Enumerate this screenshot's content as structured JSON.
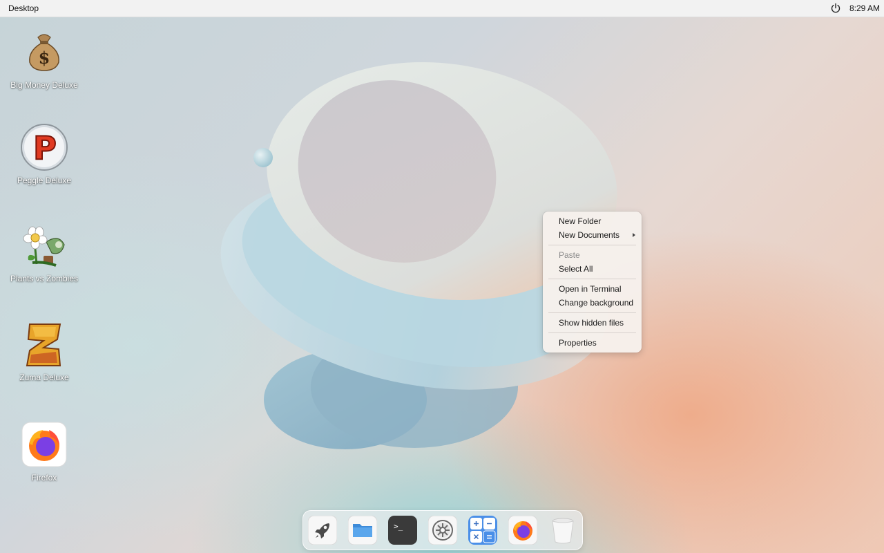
{
  "topbar": {
    "title": "Desktop",
    "time": "8:29 AM",
    "power_icon": "power-icon"
  },
  "desktop_icons": [
    {
      "label": "Big Money Deluxe",
      "icon": "money-bag-icon"
    },
    {
      "label": "Peggle Deluxe",
      "icon": "peggle-icon"
    },
    {
      "label": "Plants vs Zombies",
      "icon": "plants-vs-zombies-icon"
    },
    {
      "label": "Zuma Deluxe",
      "icon": "zuma-icon"
    },
    {
      "label": "Firefox",
      "icon": "firefox-icon"
    }
  ],
  "context_menu": {
    "items": [
      {
        "label": "New Folder",
        "enabled": true
      },
      {
        "label": "New Documents",
        "enabled": true,
        "submenu": true
      },
      {
        "label": "Paste",
        "enabled": false
      },
      {
        "label": "Select All",
        "enabled": true
      },
      {
        "label": "Open in Terminal",
        "enabled": true
      },
      {
        "label": "Change background",
        "enabled": true
      },
      {
        "label": "Show hidden files",
        "enabled": true
      },
      {
        "label": "Properties",
        "enabled": true
      }
    ]
  },
  "dock": {
    "apps": [
      {
        "name": "launcher",
        "icon": "rocket-icon"
      },
      {
        "name": "files",
        "icon": "folder-icon"
      },
      {
        "name": "terminal",
        "icon": "terminal-icon"
      },
      {
        "name": "settings",
        "icon": "gear-icon"
      },
      {
        "name": "calculator",
        "icon": "calculator-icon"
      },
      {
        "name": "firefox",
        "icon": "firefox-icon"
      },
      {
        "name": "trash",
        "icon": "trash-icon"
      }
    ],
    "terminal_glyph": ">_"
  },
  "colors": {
    "accent_blue": "#4a8fe8",
    "menu_bg": "#f6f0ec"
  }
}
